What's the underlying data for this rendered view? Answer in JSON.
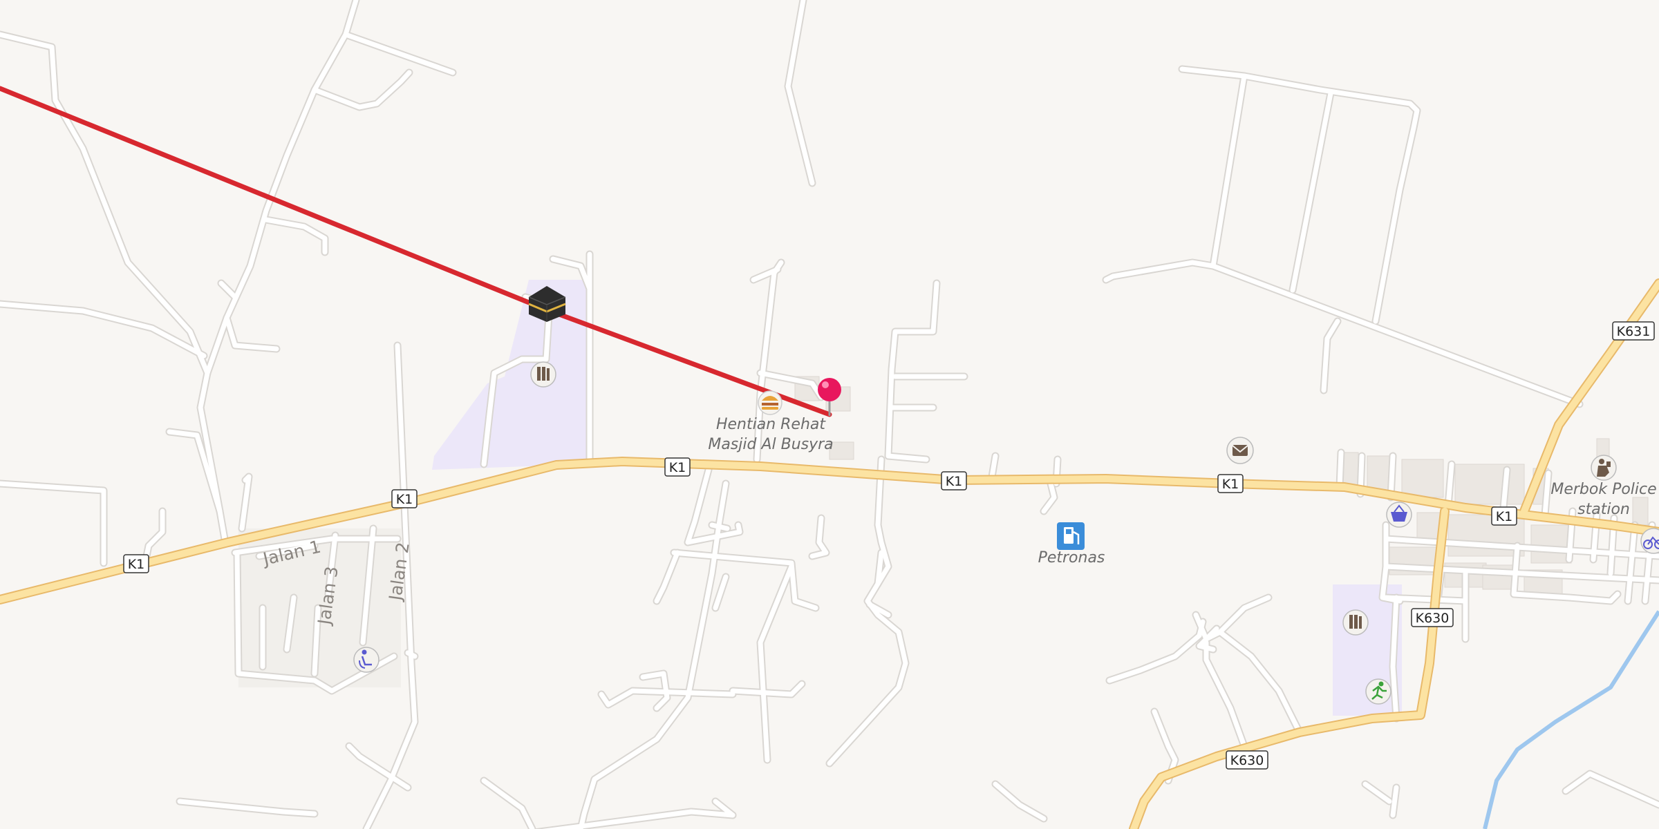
{
  "map": {
    "highways": {
      "k1": "K1",
      "k630": "K630",
      "k631": "K631"
    },
    "streets": {
      "jalan1": "Jalan 1",
      "jalan2": "Jalan 2",
      "jalan3": "Jalan 3"
    },
    "places": {
      "hentian_line1": "Hentian Rehat",
      "hentian_line2": "Masjid Al Busyra",
      "petronas": "Petronas",
      "police_line1": "Merbok Police",
      "police_line2": "station"
    },
    "icons": [
      "kaaba-icon",
      "location-pin-icon",
      "fast-food-icon",
      "library-icon",
      "mail-icon",
      "fuel-icon",
      "shopping-basket-icon",
      "police-icon",
      "bicycle-icon",
      "sports-icon",
      "accessibility-icon"
    ],
    "colors": {
      "background": "#f8f6f3",
      "road": "#ffffff",
      "road_casing": "#d9d6d2",
      "highway_fill": "#fce3a2",
      "highway_casing": "#e8b96a",
      "route_line": "#d7282f",
      "pin": "#e8175d",
      "landuse_purple": "#ece7f9",
      "water": "#9ec7ee"
    }
  }
}
